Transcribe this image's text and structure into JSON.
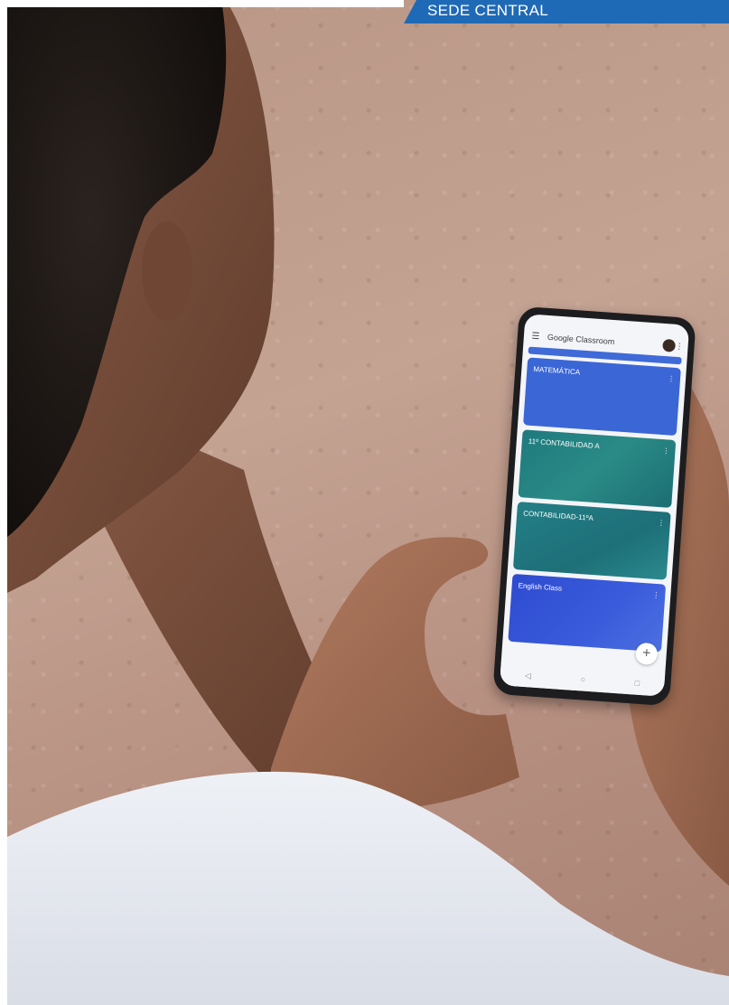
{
  "banner": {
    "label": "SEDE CENTRAL",
    "color": "#1f6ab7"
  },
  "phone": {
    "app_title": "Google Classroom",
    "icons": {
      "menu": "hamburger-menu-icon",
      "more": "more-vert-icon",
      "add": "plus-icon"
    },
    "courses": [
      {
        "name": "MATEMÁTICA",
        "color": "#3b66d6"
      },
      {
        "name": "11º CONTABILIDAD A",
        "color": "#1f7a7e"
      },
      {
        "name": "CONTABILIDAD-11ºA",
        "color": "#237f86"
      },
      {
        "name": "English Class",
        "color": "#2e4bd0"
      }
    ],
    "nav": {
      "back": "◁",
      "home": "○",
      "recents": "□"
    },
    "fab": "+"
  }
}
